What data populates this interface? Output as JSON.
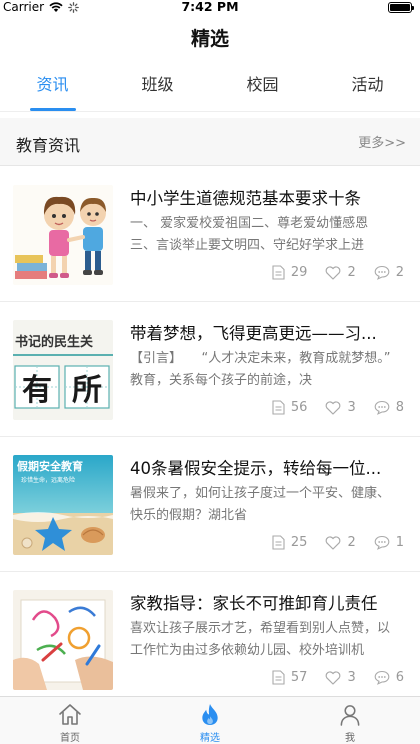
{
  "status_bar": {
    "carrier": "Carrier",
    "time": "7:42 PM"
  },
  "nav": {
    "title": "精选"
  },
  "tabs": [
    {
      "label": "资讯",
      "active": true
    },
    {
      "label": "班级",
      "active": false
    },
    {
      "label": "校园",
      "active": false
    },
    {
      "label": "活动",
      "active": false
    }
  ],
  "section": {
    "title": "教育资讯",
    "more": "更多>>"
  },
  "news": [
    {
      "title": "中小学生道德规范基本要求十条",
      "summary": "一、 爱家爱校爱祖国二、尊老爱幼懂感恩三、言谈举止要文明四、守纪好学求上进",
      "views": "29",
      "likes": "2",
      "comments": "2"
    },
    {
      "title": "带着梦想，飞得更高更远——习...",
      "summary": "【引言】　　“人才决定未来，教育成就梦想。”　　教育，关系每个孩子的前途，决",
      "thumb_text_top": "书记的民生关",
      "thumb_text_bottom": [
        "有",
        "所"
      ],
      "views": "56",
      "likes": "3",
      "comments": "8"
    },
    {
      "title": "40条暑假安全提示，转给每一位...",
      "summary": "暑假来了，如何让孩子度过一个平安、健康、快乐的假期？湖北省",
      "thumb_text_top": "假期安全教育",
      "thumb_text_sub": "珍惜生命，远离危险",
      "views": "25",
      "likes": "2",
      "comments": "1"
    },
    {
      "title": "家教指导：家长不可推卸育儿责任",
      "summary": "喜欢让孩子展示才艺，希望看到别人点赞，以工作忙为由过多依赖幼儿园、校外培训机",
      "views": "57",
      "likes": "3",
      "comments": "6"
    }
  ],
  "tabbar": [
    {
      "label": "首页",
      "icon": "home-icon",
      "active": false
    },
    {
      "label": "精选",
      "icon": "flame-icon",
      "active": true
    },
    {
      "label": "我",
      "icon": "person-icon",
      "active": false
    }
  ],
  "colors": {
    "accent": "#2a8ef0",
    "muted": "#999999"
  }
}
